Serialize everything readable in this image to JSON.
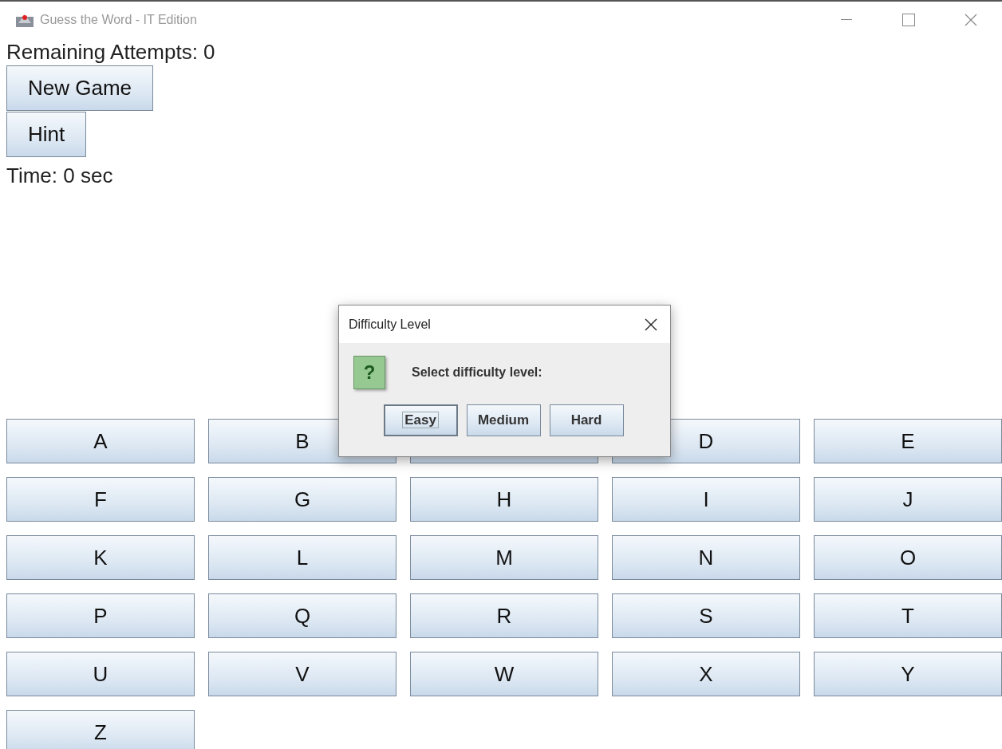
{
  "window": {
    "title": "Guess the Word - IT Edition"
  },
  "status": {
    "attempts": "Remaining Attempts: 0",
    "time": "Time: 0 sec"
  },
  "buttons": [
    {
      "label": "New Game"
    },
    {
      "label": "Hint"
    }
  ],
  "keys": [
    {
      "kind": "key",
      "label": "A"
    },
    {
      "kind": "key",
      "label": "B"
    },
    {
      "kind": "covered"
    },
    {
      "kind": "key",
      "label": "D"
    },
    {
      "kind": "key",
      "label": "E"
    },
    {
      "kind": "key",
      "label": "F"
    },
    {
      "kind": "key",
      "label": "G"
    },
    {
      "kind": "key",
      "label": "H"
    },
    {
      "kind": "key",
      "label": "I"
    },
    {
      "kind": "key",
      "label": "J"
    },
    {
      "kind": "key",
      "label": "K"
    },
    {
      "kind": "key",
      "label": "L"
    },
    {
      "kind": "key",
      "label": "M"
    },
    {
      "kind": "key",
      "label": "N"
    },
    {
      "kind": "key",
      "label": "O"
    },
    {
      "kind": "key",
      "label": "P"
    },
    {
      "kind": "key",
      "label": "Q"
    },
    {
      "kind": "key",
      "label": "R"
    },
    {
      "kind": "key",
      "label": "S"
    },
    {
      "kind": "key",
      "label": "T"
    },
    {
      "kind": "key",
      "label": "U"
    },
    {
      "kind": "key",
      "label": "V"
    },
    {
      "kind": "key",
      "label": "W"
    },
    {
      "kind": "key",
      "label": "X"
    },
    {
      "kind": "key",
      "label": "Y"
    },
    {
      "kind": "key",
      "label": "Z"
    }
  ],
  "dialog": {
    "title": "Difficulty Level",
    "message": "Select difficulty level:",
    "icon_glyph": "?",
    "options": [
      {
        "label": "Easy",
        "focused": true
      },
      {
        "label": "Medium",
        "focused": false
      },
      {
        "label": "Hard",
        "focused": false
      }
    ]
  }
}
